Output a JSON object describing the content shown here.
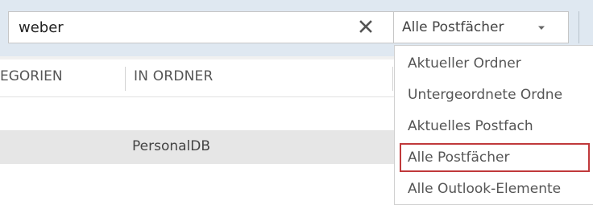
{
  "search": {
    "value": "weber",
    "clear_icon": "close-icon"
  },
  "scope": {
    "selected": "Alle Postfächer",
    "icon": "chevron-down-icon"
  },
  "columns": {
    "categories_label": "EGORIEN",
    "folder_label": "IN ORDNER"
  },
  "rows": [
    {
      "folder": ""
    },
    {
      "folder": "PersonalDB"
    }
  ],
  "dropdown": {
    "items": [
      {
        "label": "Aktueller Ordner"
      },
      {
        "label": "Untergeordnete Ordne"
      },
      {
        "label": "Aktuelles Postfach"
      },
      {
        "label": "Alle Postfächer"
      },
      {
        "label": "Alle Outlook-Elemente"
      }
    ],
    "selected_index": 3,
    "selected_outline_color": "#c0393b"
  },
  "colors": {
    "topbar_bg": "#dfe8f1",
    "row_highlight": "#e6e6e6"
  }
}
